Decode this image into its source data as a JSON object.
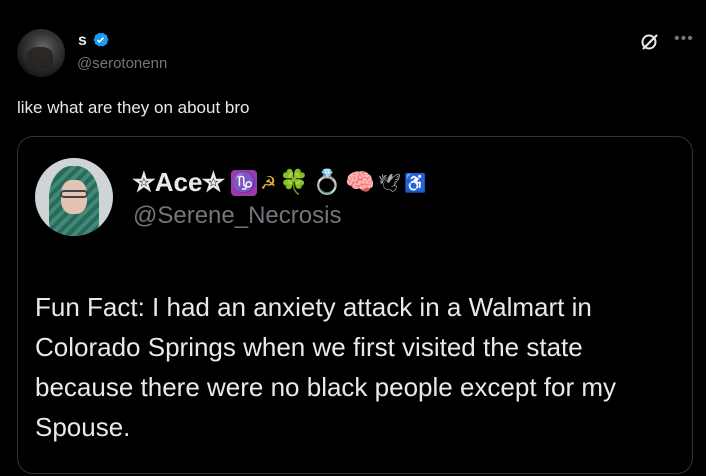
{
  "post": {
    "author_name": "s",
    "author_handle": "@serotonenn",
    "text": "like what are they on about bro",
    "more_icon": "more-icon",
    "grok_icon": "grok-icon"
  },
  "quote": {
    "name": "✮Ace✮",
    "emojis": [
      "♑",
      "☭",
      "🍀",
      "💍",
      "🧠",
      "🕊",
      "♿"
    ],
    "handle": "@Serene_Necrosis",
    "text": "Fun Fact: I had an anxiety attack in a Walmart in Colorado Springs when we first visited the state because there were no black people except for my Spouse."
  },
  "colors": {
    "background": "#000000",
    "text": "#e7e9ea",
    "muted": "#71767b",
    "border": "#2f3336",
    "verified": "#1d9bf0"
  }
}
